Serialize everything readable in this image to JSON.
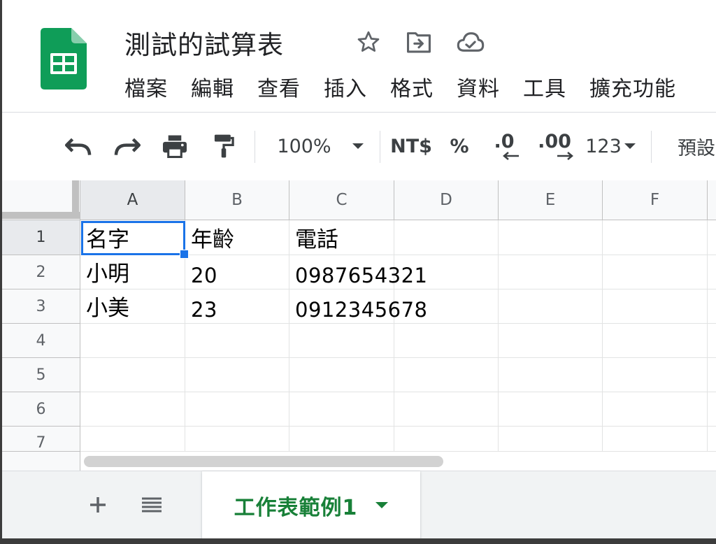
{
  "document": {
    "title": "測試的試算表"
  },
  "menu": {
    "items": [
      "檔案",
      "編輯",
      "查看",
      "插入",
      "格式",
      "資料",
      "工具",
      "擴充功能"
    ]
  },
  "toolbar": {
    "zoom": "100%",
    "currency": "NT$",
    "percent": "%",
    "decrease_decimal": ".0",
    "increase_decimal": ".00",
    "more_formats": "123",
    "font": "預設"
  },
  "grid": {
    "columns": [
      "A",
      "B",
      "C",
      "D",
      "E",
      "F"
    ],
    "rows": [
      "1",
      "2",
      "3",
      "4",
      "5",
      "6",
      "7"
    ],
    "cells": [
      [
        "名字",
        "年齡",
        "電話",
        "",
        "",
        ""
      ],
      [
        "小明",
        "20",
        "0987654321",
        "",
        "",
        ""
      ],
      [
        "小美",
        "23",
        "0912345678",
        "",
        "",
        ""
      ],
      [
        "",
        "",
        "",
        "",
        "",
        ""
      ],
      [
        "",
        "",
        "",
        "",
        "",
        ""
      ],
      [
        "",
        "",
        "",
        "",
        "",
        ""
      ],
      [
        "",
        "",
        "",
        "",
        "",
        ""
      ]
    ],
    "selected_cell": "A1"
  },
  "sheets": {
    "tabs": [
      {
        "label": "工作表範例1",
        "active": true
      }
    ]
  },
  "colors": {
    "brand_green": "#188038",
    "selection_blue": "#1a73e8",
    "logo_green": "#0f9d58"
  }
}
